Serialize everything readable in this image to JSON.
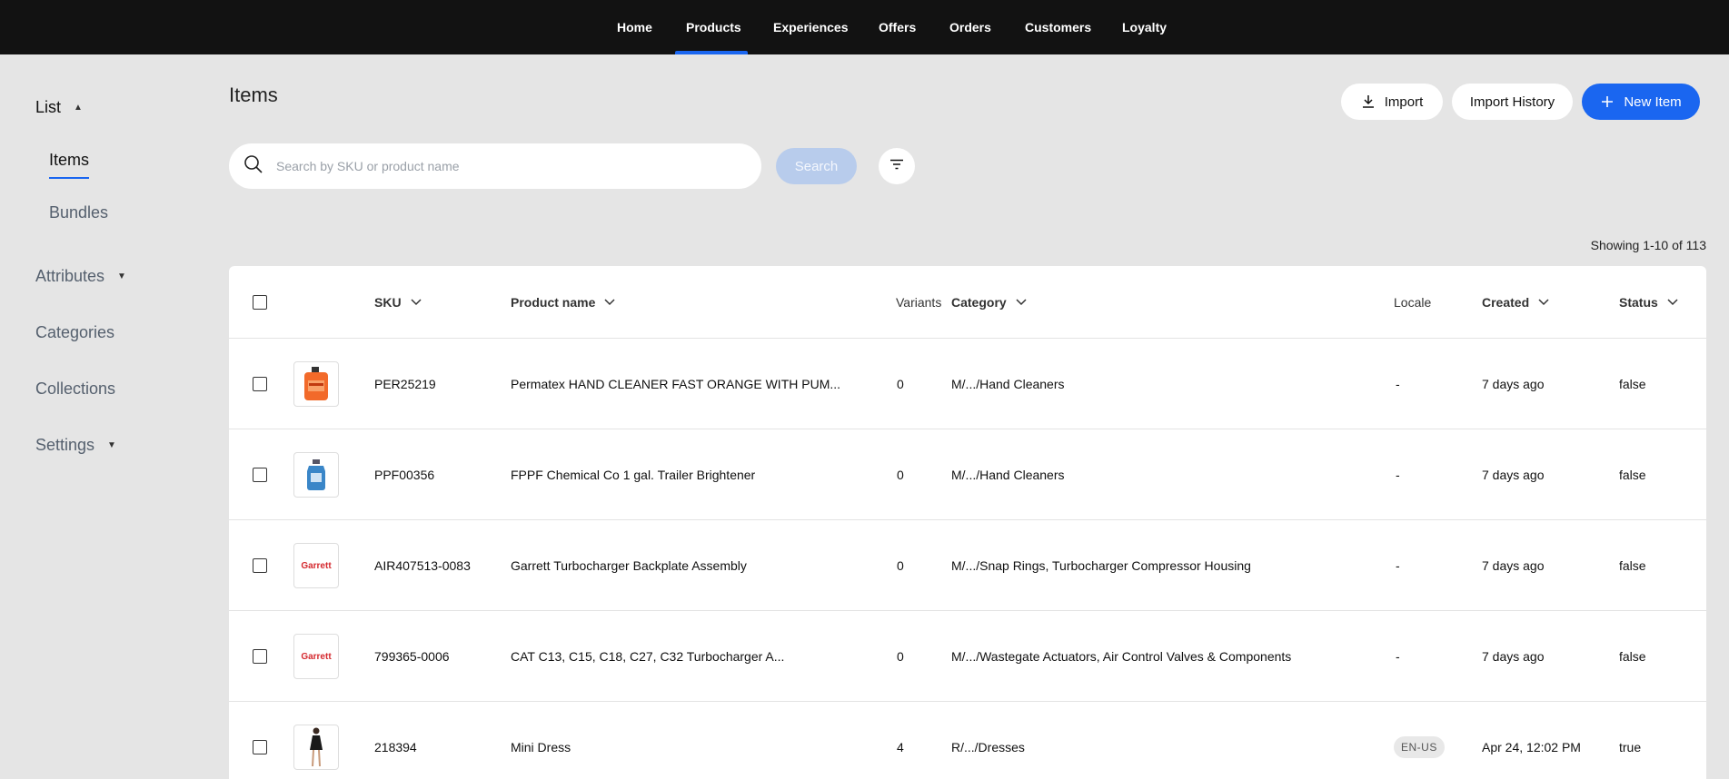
{
  "nav": {
    "items": [
      {
        "label": "Home"
      },
      {
        "label": "Products"
      },
      {
        "label": "Experiences"
      },
      {
        "label": "Offers"
      },
      {
        "label": "Orders"
      },
      {
        "label": "Customers"
      },
      {
        "label": "Loyalty"
      }
    ],
    "active": "Products",
    "accent": "#1a66f0"
  },
  "sidebar": {
    "list_label": "List",
    "sub_items": [
      {
        "label": "Items"
      },
      {
        "label": "Bundles"
      }
    ],
    "items": [
      {
        "label": "Attributes",
        "icon": "caret-down-icon"
      },
      {
        "label": "Categories"
      },
      {
        "label": "Collections"
      },
      {
        "label": "Settings",
        "icon": "caret-down-icon"
      }
    ]
  },
  "page": {
    "title": "Items",
    "import_label": "Import",
    "import_history_label": "Import History",
    "new_item_label": "New Item"
  },
  "search": {
    "placeholder": "Search by SKU or product name",
    "button_label": "Search"
  },
  "pagination": {
    "showing": "Showing 1-10 of 113"
  },
  "table": {
    "columns": {
      "sku": "SKU",
      "product_name": "Product name",
      "variants": "Variants",
      "category": "Category",
      "locale": "Locale",
      "created": "Created",
      "status": "Status"
    },
    "rows": [
      {
        "sku": "PER25219",
        "name": "Permatex HAND CLEANER FAST ORANGE WITH PUM...",
        "variants": "0",
        "category": "M/.../Hand Cleaners",
        "locale": "-",
        "created": "7 days ago",
        "status": "false",
        "thumb": "orange-jug"
      },
      {
        "sku": "PPF00356",
        "name": "FPPF Chemical Co 1 gal. Trailer Brightener",
        "variants": "0",
        "category": "M/.../Hand Cleaners",
        "locale": "-",
        "created": "7 days ago",
        "status": "false",
        "thumb": "blue-jug"
      },
      {
        "sku": "AIR407513-0083",
        "name": "Garrett Turbocharger Backplate Assembly",
        "variants": "0",
        "category": "M/.../Snap Rings, Turbocharger Compressor Housing",
        "locale": "-",
        "created": "7 days ago",
        "status": "false",
        "thumb": "garrett-logo",
        "thumb_text": "Garrett"
      },
      {
        "sku": "799365-0006",
        "name": "CAT C13, C15, C18, C27, C32 Turbocharger A...",
        "variants": "0",
        "category": "M/.../Wastegate Actuators, Air Control Valves & Components",
        "locale": "-",
        "created": "7 days ago",
        "status": "false",
        "thumb": "garrett-logo",
        "thumb_text": "Garrett"
      },
      {
        "sku": "218394",
        "name": "Mini Dress",
        "variants": "4",
        "category": "R/.../Dresses",
        "locale": "EN-US",
        "created": "Apr 24, 12:02 PM",
        "status": "true",
        "thumb": "dress-photo"
      }
    ]
  }
}
